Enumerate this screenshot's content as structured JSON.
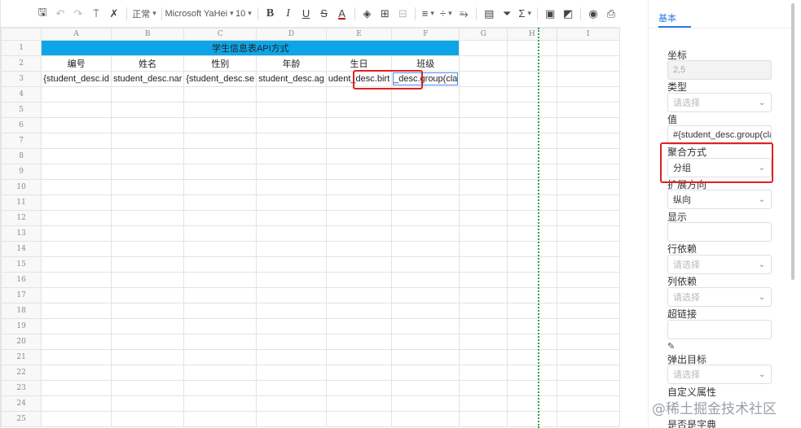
{
  "toolbar": {
    "style_select": "正常",
    "font_select": "Microsoft YaHei",
    "size_select": "10",
    "bold": "B",
    "italic": "I",
    "underline": "U",
    "strike": "S",
    "font_color": "A",
    "icons": [
      "save-icon",
      "undo-icon",
      "redo-icon",
      "format-painter-icon",
      "clear-format-icon",
      "paint-bucket-icon",
      "border-icon",
      "merge-icon",
      "align-icon",
      "valign-icon",
      "wrap-icon",
      "freeze-icon",
      "filter-icon",
      "sum-icon",
      "image-icon",
      "chart-icon",
      "preview-icon",
      "print-icon"
    ]
  },
  "sheet": {
    "columns": [
      "A",
      "B",
      "C",
      "D",
      "E",
      "F",
      "G",
      "H",
      "I"
    ],
    "rows": [
      "1",
      "2",
      "3",
      "4",
      "5",
      "6",
      "7",
      "8",
      "9",
      "10",
      "11",
      "12",
      "13",
      "14",
      "15",
      "16",
      "17",
      "18",
      "19",
      "20",
      "21",
      "22",
      "23",
      "24",
      "25"
    ],
    "title": "学生信息表API方式",
    "headers": [
      "编号",
      "姓名",
      "性别",
      "年龄",
      "生日",
      "班级"
    ],
    "data_row": [
      "{student_desc.id",
      "student_desc.nar",
      "{student_desc.se",
      "student_desc.ag",
      "udent_desc.birt",
      "_desc.group(cla"
    ],
    "title_color": "#0ea5e8",
    "highlight_color": "#e02020"
  },
  "panel": {
    "tab": "基本",
    "coord_label": "坐标",
    "coord_value": "2,5",
    "type_label": "类型",
    "type_placeholder": "请选择",
    "value_label": "值",
    "value_value": "#{student_desc.group(cla",
    "agg_label": "聚合方式",
    "agg_value": "分组",
    "expand_label": "扩展方向",
    "expand_value": "纵向",
    "display_label": "显示",
    "row_dep_label": "行依赖",
    "row_dep_placeholder": "请选择",
    "col_dep_label": "列依赖",
    "col_dep_placeholder": "请选择",
    "link_label": "超链接",
    "popup_label": "弹出目标",
    "popup_placeholder": "请选择",
    "custom_label": "自定义属性",
    "bottom_label": "是否是字典"
  },
  "watermark": "@稀土掘金技术社区"
}
